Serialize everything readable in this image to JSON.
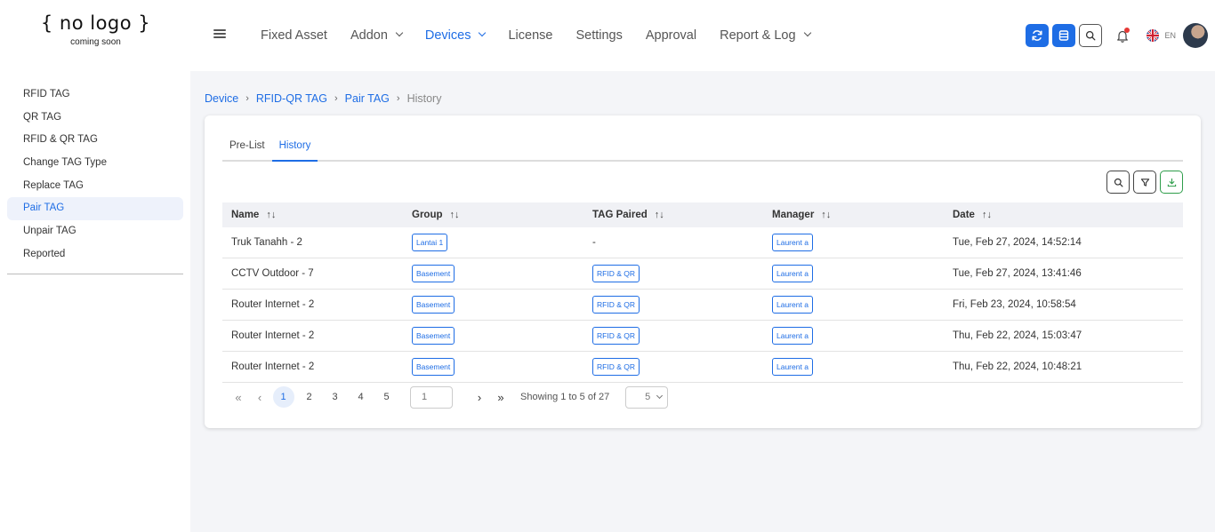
{
  "brand": {
    "logo_text": "{ no logo }",
    "logo_sub": "coming soon"
  },
  "nav": {
    "items": [
      {
        "label": "Fixed Asset",
        "dropdown": false,
        "active": false
      },
      {
        "label": "Addon",
        "dropdown": true,
        "active": false
      },
      {
        "label": "Devices",
        "dropdown": true,
        "active": true
      },
      {
        "label": "License",
        "dropdown": false,
        "active": false
      },
      {
        "label": "Settings",
        "dropdown": false,
        "active": false
      },
      {
        "label": "Approval",
        "dropdown": false,
        "active": false
      },
      {
        "label": "Report & Log",
        "dropdown": true,
        "active": false
      }
    ]
  },
  "header_right": {
    "buttons": [
      "sync-icon",
      "list-icon",
      "search-icon"
    ],
    "notification_icon": "bell-icon",
    "flag_icon": "uk-flag-icon",
    "language": "EN"
  },
  "sidebar": {
    "items": [
      {
        "label": "RFID TAG",
        "active": false
      },
      {
        "label": "QR TAG",
        "active": false
      },
      {
        "label": "RFID & QR TAG",
        "active": false
      },
      {
        "label": "Change TAG Type",
        "active": false
      },
      {
        "label": "Replace TAG",
        "active": false
      },
      {
        "label": "Pair TAG",
        "active": true
      },
      {
        "label": "Unpair TAG",
        "active": false
      },
      {
        "label": "Reported",
        "active": false
      }
    ]
  },
  "breadcrumb": {
    "links": [
      "Device",
      "RFID-QR TAG",
      "Pair TAG"
    ],
    "current": "History"
  },
  "tabs": [
    {
      "label": "Pre-List",
      "active": false
    },
    {
      "label": "History",
      "active": true
    }
  ],
  "toolbar": {
    "icons": [
      "search-icon",
      "filter-icon",
      "download-icon"
    ]
  },
  "table": {
    "columns": [
      "Name",
      "Group",
      "TAG Paired",
      "Manager",
      "Date"
    ],
    "rows": [
      {
        "name": "Truk Tanahh - 2",
        "group": "Lantai 1",
        "tag_paired": "-",
        "manager": "Laurent a",
        "date": "Tue, Feb 27, 2024, 14:52:14"
      },
      {
        "name": "CCTV Outdoor - 7",
        "group": "Basement",
        "tag_paired": "RFID & QR",
        "manager": "Laurent a",
        "date": "Tue, Feb 27, 2024, 13:41:46"
      },
      {
        "name": "Router Internet - 2",
        "group": "Basement",
        "tag_paired": "RFID & QR",
        "manager": "Laurent a",
        "date": "Fri, Feb 23, 2024, 10:58:54"
      },
      {
        "name": "Router Internet - 2",
        "group": "Basement",
        "tag_paired": "RFID & QR",
        "manager": "Laurent a",
        "date": "Thu, Feb 22, 2024, 15:03:47"
      },
      {
        "name": "Router Internet - 2",
        "group": "Basement",
        "tag_paired": "RFID & QR",
        "manager": "Laurent a",
        "date": "Thu, Feb 22, 2024, 10:48:21"
      }
    ]
  },
  "pagination": {
    "pages": [
      "1",
      "2",
      "3",
      "4",
      "5"
    ],
    "current_page": "1",
    "jump_placeholder": "1",
    "info": "Showing 1 to 5 of 27",
    "page_size": "5"
  },
  "colors": {
    "accent": "#1e6de5",
    "download": "#2e9d4a",
    "notification_dot": "#e53935"
  }
}
